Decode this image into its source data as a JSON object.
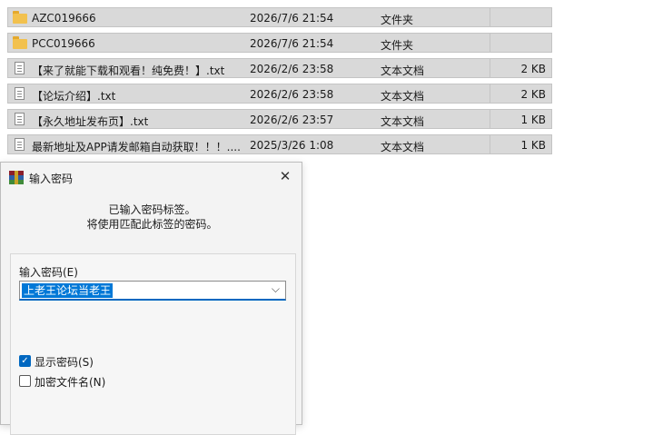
{
  "files": [
    {
      "icon": "folder-icon",
      "name": "AZC019666",
      "date": "2026/7/6 21:54",
      "type": "文件夹",
      "size": ""
    },
    {
      "icon": "folder-icon",
      "name": "PCC019666",
      "date": "2026/7/6 21:54",
      "type": "文件夹",
      "size": ""
    },
    {
      "icon": "text-file-icon",
      "name": "【来了就能下载和观看！纯免费！】.txt",
      "date": "2026/2/6 23:58",
      "type": "文本文档",
      "size": "2 KB"
    },
    {
      "icon": "text-file-icon",
      "name": "【论坛介绍】.txt",
      "date": "2026/2/6 23:58",
      "type": "文本文档",
      "size": "2 KB"
    },
    {
      "icon": "text-file-icon",
      "name": "【永久地址发布页】.txt",
      "date": "2026/2/6 23:57",
      "type": "文本文档",
      "size": "1 KB"
    },
    {
      "icon": "text-file-icon",
      "name": "最新地址及APP请发邮箱自动获取！！！....",
      "date": "2025/3/26 1:08",
      "type": "文本文档",
      "size": "1 KB"
    }
  ],
  "dialog": {
    "title": "输入密码",
    "close_glyph": "✕",
    "message_line1": "已输入密码标签。",
    "message_line2": "将使用匹配此标签的密码。",
    "password_label": "输入密码(E)",
    "password_value": "上老王论坛当老王",
    "dropdown_glyph": "⌵",
    "show_password_label": "显示密码(S)",
    "show_password_checked": true,
    "check_glyph": "✓",
    "encrypt_names_label": "加密文件名(N)",
    "encrypt_names_checked": false
  },
  "colors": {
    "accent": "#0078d7",
    "row_background": "#d9d9d9",
    "folder": "#f2c14e"
  }
}
